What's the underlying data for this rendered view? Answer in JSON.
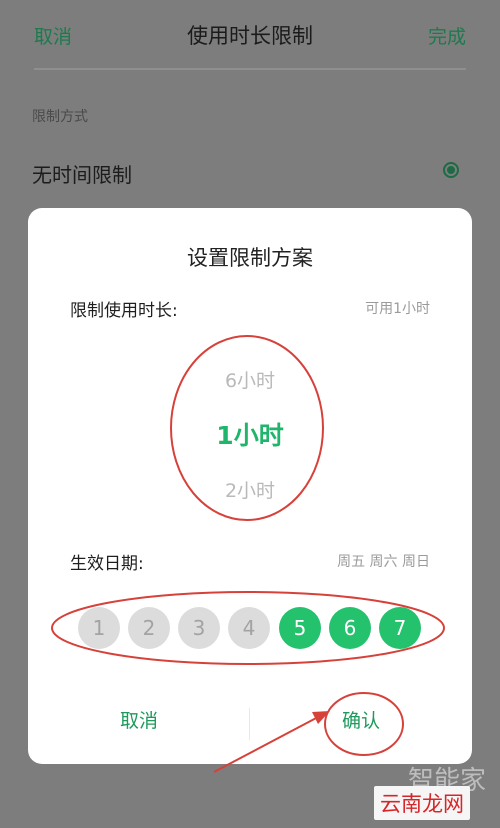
{
  "header": {
    "cancel": "取消",
    "title": "使用时长限制",
    "done": "完成"
  },
  "settings": {
    "section_label": "限制方式",
    "option_label": "无时间限制"
  },
  "dialog": {
    "title": "设置限制方案",
    "duration_label": "限制使用时长:",
    "duration_hint": "可用1小时",
    "picker": {
      "previous": "6小时",
      "selected": "1小时",
      "next": "2小时"
    },
    "date_label": "生效日期:",
    "date_hint": "周五 周六 周日",
    "days": [
      {
        "label": "1",
        "selected": false
      },
      {
        "label": "2",
        "selected": false
      },
      {
        "label": "3",
        "selected": false
      },
      {
        "label": "4",
        "selected": false
      },
      {
        "label": "5",
        "selected": true
      },
      {
        "label": "6",
        "selected": true
      },
      {
        "label": "7",
        "selected": true
      }
    ],
    "cancel_button": "取消",
    "confirm_button": "确认"
  },
  "watermark": {
    "top": "智能家",
    "bottom": "云南龙网"
  },
  "colors": {
    "accent": "#25c26e",
    "annotation": "#d6413a"
  }
}
